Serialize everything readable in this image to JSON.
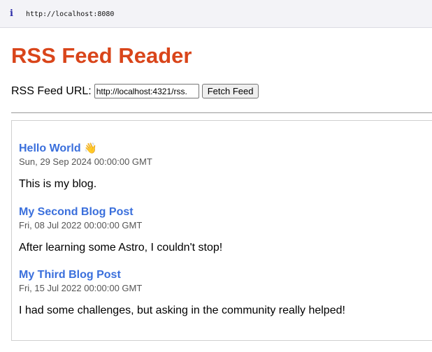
{
  "browser": {
    "url": "http://localhost:8080"
  },
  "page": {
    "title": "RSS Feed Reader",
    "form": {
      "label": "RSS Feed URL:",
      "input_value": "http://localhost:4321/rss.",
      "button_label": "Fetch Feed"
    }
  },
  "feed": {
    "items": [
      {
        "title": "Hello World",
        "emoji": "👋",
        "date": "Sun, 29 Sep 2024 00:00:00 GMT",
        "description": "This is my blog."
      },
      {
        "title": "My Second Blog Post",
        "date": "Fri, 08 Jul 2022 00:00:00 GMT",
        "description": "After learning some Astro, I couldn't stop!"
      },
      {
        "title": "My Third Blog Post",
        "date": "Fri, 15 Jul 2022 00:00:00 GMT",
        "description": "I had some challenges, but asking in the community really helped!"
      }
    ]
  },
  "colors": {
    "title": "#d9451a",
    "link": "#3a6fdc"
  },
  "icons": {
    "urlbar": "info-icon",
    "item_0": "waving-hand-icon"
  }
}
